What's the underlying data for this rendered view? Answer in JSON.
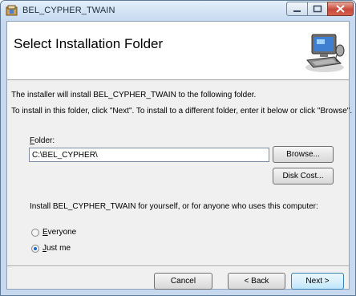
{
  "window": {
    "title": "BEL_CYPHER_TWAIN"
  },
  "banner": {
    "title": "Select Installation Folder",
    "art": "computer-setup-icon"
  },
  "body": {
    "line1": "The installer will install BEL_CYPHER_TWAIN to the following folder.",
    "line2": "To install in this folder, click \"Next\". To install to a different folder, enter it below or click \"Browse\"."
  },
  "folder": {
    "label_accel": "F",
    "label_rest": "older:",
    "value": "C:\\BEL_CYPHER\\"
  },
  "buttons": {
    "browse": "Browse...",
    "disk_cost": "Disk Cost...",
    "cancel": "Cancel",
    "back": "< Back",
    "next": "Next >"
  },
  "install_for": {
    "prompt": "Install BEL_CYPHER_TWAIN for yourself, or for anyone who uses this computer:",
    "options": [
      {
        "accel": "",
        "label_pre": "E",
        "label_rest": "veryone",
        "selected": false
      },
      {
        "accel": "",
        "label_pre": "J",
        "label_rest": "ust me",
        "selected": true
      }
    ]
  }
}
